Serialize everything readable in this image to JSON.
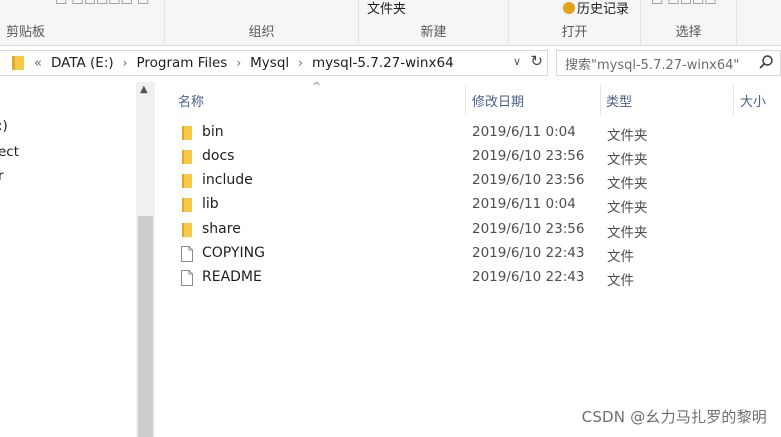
{
  "ribbon": {
    "clipboard_group": "剪贴板",
    "organize_group": "组织",
    "new_group": "新建",
    "open_group": "打开",
    "select_group": "选择",
    "new_folder_label": "文件夹",
    "history_label": "历史记录"
  },
  "address": {
    "overflow": "«",
    "crumbs": [
      "DATA (E:)",
      "Program Files",
      "Mysql",
      "mysql-5.7.27-winx64"
    ],
    "search_placeholder": "搜索\"mysql-5.7.27-winx64\""
  },
  "nav": {
    "items": [
      ":)",
      "ect",
      "r"
    ]
  },
  "columns": {
    "name": "名称",
    "date": "修改日期",
    "type": "类型",
    "size": "大小"
  },
  "files": [
    {
      "name": "bin",
      "date": "2019/6/11 0:04",
      "type": "文件夹",
      "icon": "folder-icon"
    },
    {
      "name": "docs",
      "date": "2019/6/10 23:56",
      "type": "文件夹",
      "icon": "folder-icon"
    },
    {
      "name": "include",
      "date": "2019/6/10 23:56",
      "type": "文件夹",
      "icon": "folder-icon"
    },
    {
      "name": "lib",
      "date": "2019/6/11 0:04",
      "type": "文件夹",
      "icon": "folder-icon"
    },
    {
      "name": "share",
      "date": "2019/6/10 23:56",
      "type": "文件夹",
      "icon": "folder-icon"
    },
    {
      "name": "COPYING",
      "date": "2019/6/10 22:43",
      "type": "文件",
      "icon": "file-icon"
    },
    {
      "name": "README",
      "date": "2019/6/10 22:43",
      "type": "文件",
      "icon": "file-icon"
    }
  ],
  "watermark": "CSDN @幺力马扎罗的黎明",
  "colors": {
    "folder": "#f7c948",
    "folder_dark": "#e3a923",
    "header_text": "#4a5f8a"
  }
}
